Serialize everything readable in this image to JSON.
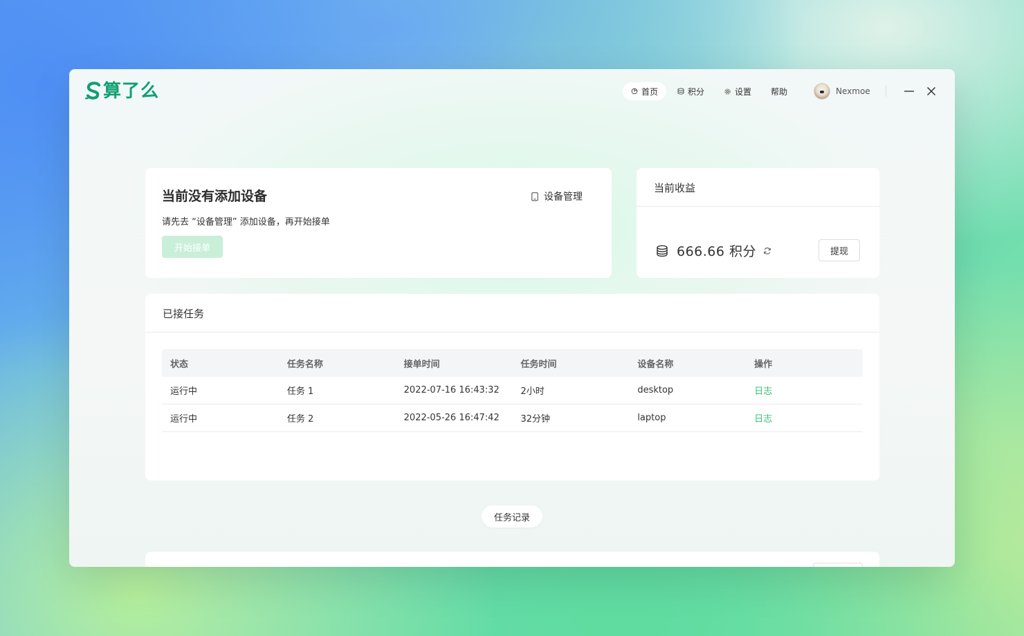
{
  "app": {
    "logo_text": "算了么",
    "brand_color": "#11a070",
    "accent_green": "#3cc07a"
  },
  "nav": {
    "items": [
      {
        "label": "首页",
        "icon": "home-icon",
        "active": true
      },
      {
        "label": "积分",
        "icon": "coins-icon",
        "active": false
      },
      {
        "label": "设置",
        "icon": "gear-icon",
        "active": false
      },
      {
        "label": "帮助",
        "icon": "",
        "active": false
      }
    ]
  },
  "user": {
    "name": "Nexmoe",
    "avatar_icon": "avatar-icon"
  },
  "window_controls": {
    "minimize_icon": "minimize-icon",
    "close_icon": "close-icon"
  },
  "device_card": {
    "title": "当前没有添加设备",
    "manage_label": "设备管理",
    "manage_icon": "tablet-icon",
    "description": "请先去 “设备管理” 添加设备，再开始接单",
    "start_label": "开始接单"
  },
  "income_card": {
    "title": "当前收益",
    "value": "666.66 积分",
    "coins_icon": "database-icon",
    "refresh_icon": "refresh-icon",
    "withdraw_label": "提现"
  },
  "tasks_card": {
    "title": "已接任务",
    "columns": [
      "状态",
      "任务名称",
      "接单时间",
      "任务时间",
      "设备名称",
      "操作"
    ],
    "rows": [
      [
        "运行中",
        "任务 1",
        "2022-07-16 16:43:32",
        "2小时",
        "desktop",
        "日志"
      ],
      [
        "运行中",
        "任务 2",
        "2022-05-26 16:47:42",
        "32分钟",
        "laptop",
        "日志"
      ]
    ]
  },
  "history_label": "任务记录"
}
